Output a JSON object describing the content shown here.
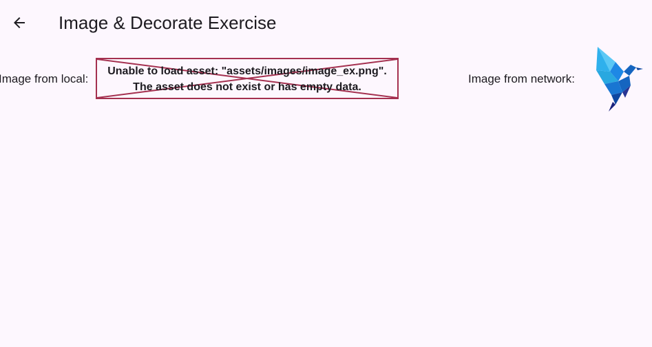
{
  "appbar": {
    "title": "Image & Decorate Exercise",
    "back_icon": "arrow-back-icon"
  },
  "content": {
    "local_label": "Image from local:",
    "local_error": {
      "line1": "Unable to load asset: \"assets/images/image_ex.png\".",
      "line2": "The asset does not exist or has empty data."
    },
    "network_label": "Image from network:",
    "network_image": "flutter-bird-logo"
  },
  "colors": {
    "background": "#fdf7fe",
    "error_border": "#a4304f",
    "text": "#1d1b20"
  }
}
